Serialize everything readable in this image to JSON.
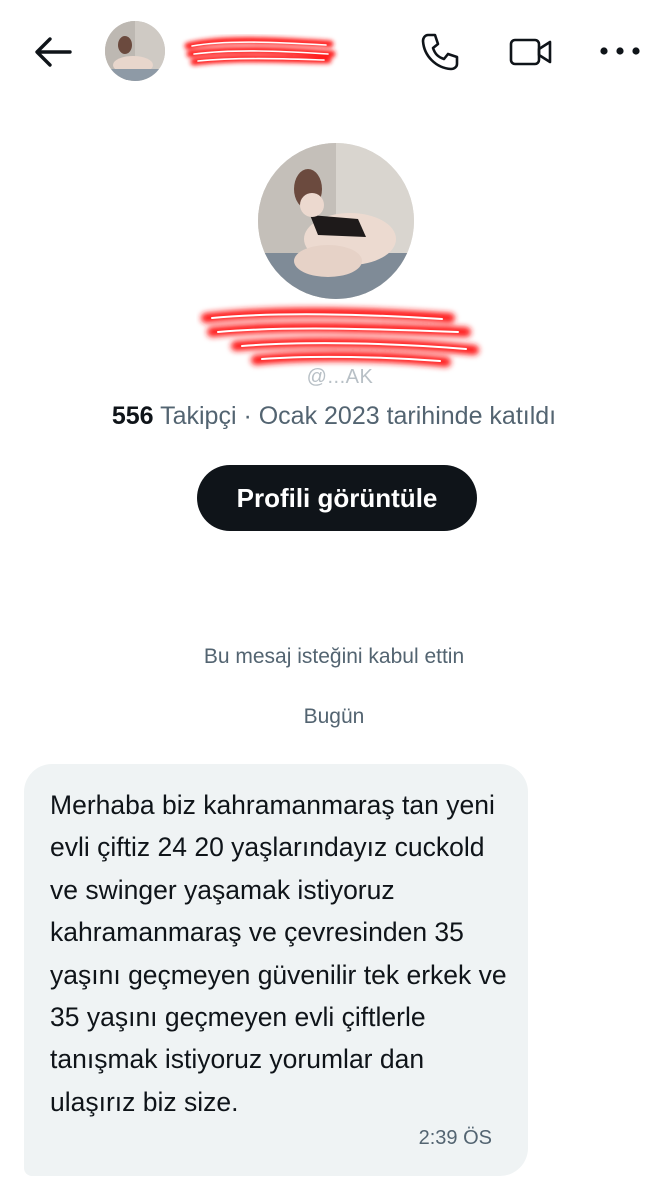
{
  "header": {
    "back_icon": "arrow-left-icon",
    "call_icon": "phone-icon",
    "video_icon": "video-camera-icon",
    "more_icon": "more-horizontal-icon",
    "scribble_color": "#ff1a1a"
  },
  "profile": {
    "handle": "@...AK",
    "followers_count": "556",
    "followers_label": "Takipçi",
    "joined_text": "· Ocak 2023 tarihinde katıldı",
    "view_profile_button": "Profili görüntüle"
  },
  "conversation": {
    "request_notice": "Bu mesaj isteğini kabul ettin",
    "day_label": "Bugün",
    "messages": [
      {
        "text": "Merhaba biz kahramanmaraş tan yeni evli çiftiz 24 20 yaşlarındayız cuckold ve swinger yaşamak istiyoruz kahramanmaraş ve çevresinden 35 yaşını geçmeyen güvenilir tek erkek ve 35 yaşını geçmeyen evli çiftlerle tanışmak istiyoruz yorumlar dan ulaşırız biz size.",
        "time": "2:39 ÖS"
      }
    ]
  },
  "colors": {
    "text_primary": "#0f1419",
    "text_secondary": "#536471",
    "bubble_bg": "#eff3f4",
    "button_bg": "#0f1419"
  }
}
